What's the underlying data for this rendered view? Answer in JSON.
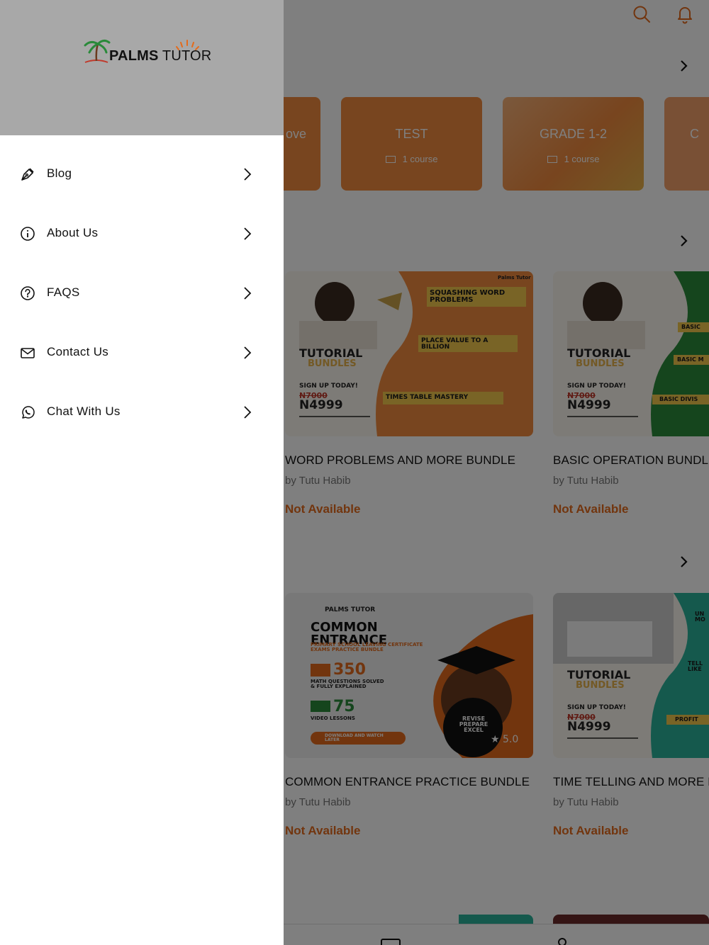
{
  "app": {
    "header_icons": [
      "search-icon",
      "bell-icon"
    ],
    "categories": [
      {
        "name": "ove",
        "count": ""
      },
      {
        "name": "TEST",
        "count": "1 course"
      },
      {
        "name": "GRADE 1-2",
        "count": "1 course"
      },
      {
        "name": "C",
        "count": ""
      }
    ],
    "courses": [
      {
        "title": "WORD PROBLEMS AND MORE BUNDLE",
        "author": "by Tutu Habib",
        "status": "Not Available",
        "poster": {
          "heading": "TUTORIAL",
          "subheading": "BUNDLES",
          "signup": "SIGN UP TODAY!",
          "old_price": "N7000",
          "price": "N4999",
          "topics": [
            "SQUASHING WORD PROBLEMS",
            "PLACE VALUE TO A BILLION",
            "TIMES TABLE MASTERY"
          ],
          "brand": "Palms Tutor"
        }
      },
      {
        "title": "BASIC OPERATION BUNDLE",
        "author": "by Tutu Habib",
        "status": "Not Available",
        "poster": {
          "heading": "TUTORIAL",
          "subheading": "BUNDLES",
          "signup": "SIGN UP TODAY!",
          "old_price": "N7000",
          "price": "N4999",
          "topics": [
            "BASIC",
            "BASIC M",
            "BASIC DIVIS"
          ]
        }
      },
      {
        "title": "COMMON ENTRANCE PRACTICE BUNDLE",
        "author": "by Tutu Habib",
        "status": "Not Available",
        "poster": {
          "brand": "PALMS TUTOR",
          "heading": "COMMON ENTRANCE",
          "subheading": "PRIMARY SCHOOL LEAVING CERTIFICATE EXAMS PRACTICE BUNDLE",
          "stat1": "350",
          "stat1_label": "MATH QUESTIONS SOLVED & FULLY EXPLAINED",
          "stat2": "75",
          "stat2_label": "VIDEO LESSONS",
          "cta": "DOWNLOAD AND WATCH LATER",
          "badge": "REVISE PREPARE EXCEL",
          "rating": "5.0"
        }
      },
      {
        "title": "TIME TELLING AND MORE BU",
        "author": "by Tutu Habib",
        "status": "Not Available",
        "poster": {
          "heading": "TUTORIAL",
          "subheading": "BUNDLES",
          "signup": "SIGN UP TODAY!",
          "old_price": "N7000",
          "price": "N4999",
          "topics": [
            "UN MO",
            "TELL LIKE",
            "PROFIT"
          ]
        }
      }
    ],
    "colors": {
      "accent": "#e46b1c",
      "orange_card": "#f08a3e",
      "green": "#2a8a3a"
    }
  },
  "drawer": {
    "logo": {
      "bold": "PALMS",
      "light": " TUTOR"
    },
    "items": [
      {
        "label": "Blog",
        "icon": "pen-nib-icon"
      },
      {
        "label": "About Us",
        "icon": "info-circle-icon"
      },
      {
        "label": "FAQS",
        "icon": "question-circle-icon"
      },
      {
        "label": "Contact Us",
        "icon": "envelope-icon"
      },
      {
        "label": "Chat With Us",
        "icon": "whatsapp-icon"
      }
    ]
  }
}
